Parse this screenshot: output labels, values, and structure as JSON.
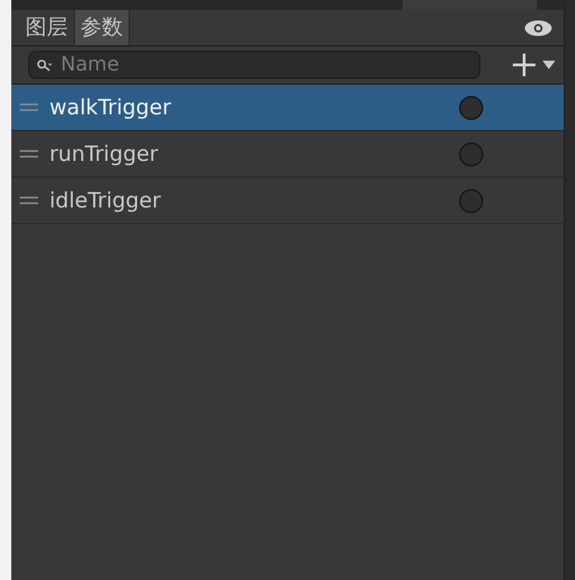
{
  "tabs": [
    {
      "label": "图层",
      "selected": false
    },
    {
      "label": "参数",
      "selected": true
    }
  ],
  "search": {
    "placeholder": "Name"
  },
  "parameters": [
    {
      "name": "walkTrigger",
      "selected": true,
      "on": false
    },
    {
      "name": "runTrigger",
      "selected": false,
      "on": false
    },
    {
      "name": "idleTrigger",
      "selected": false,
      "on": false
    }
  ]
}
